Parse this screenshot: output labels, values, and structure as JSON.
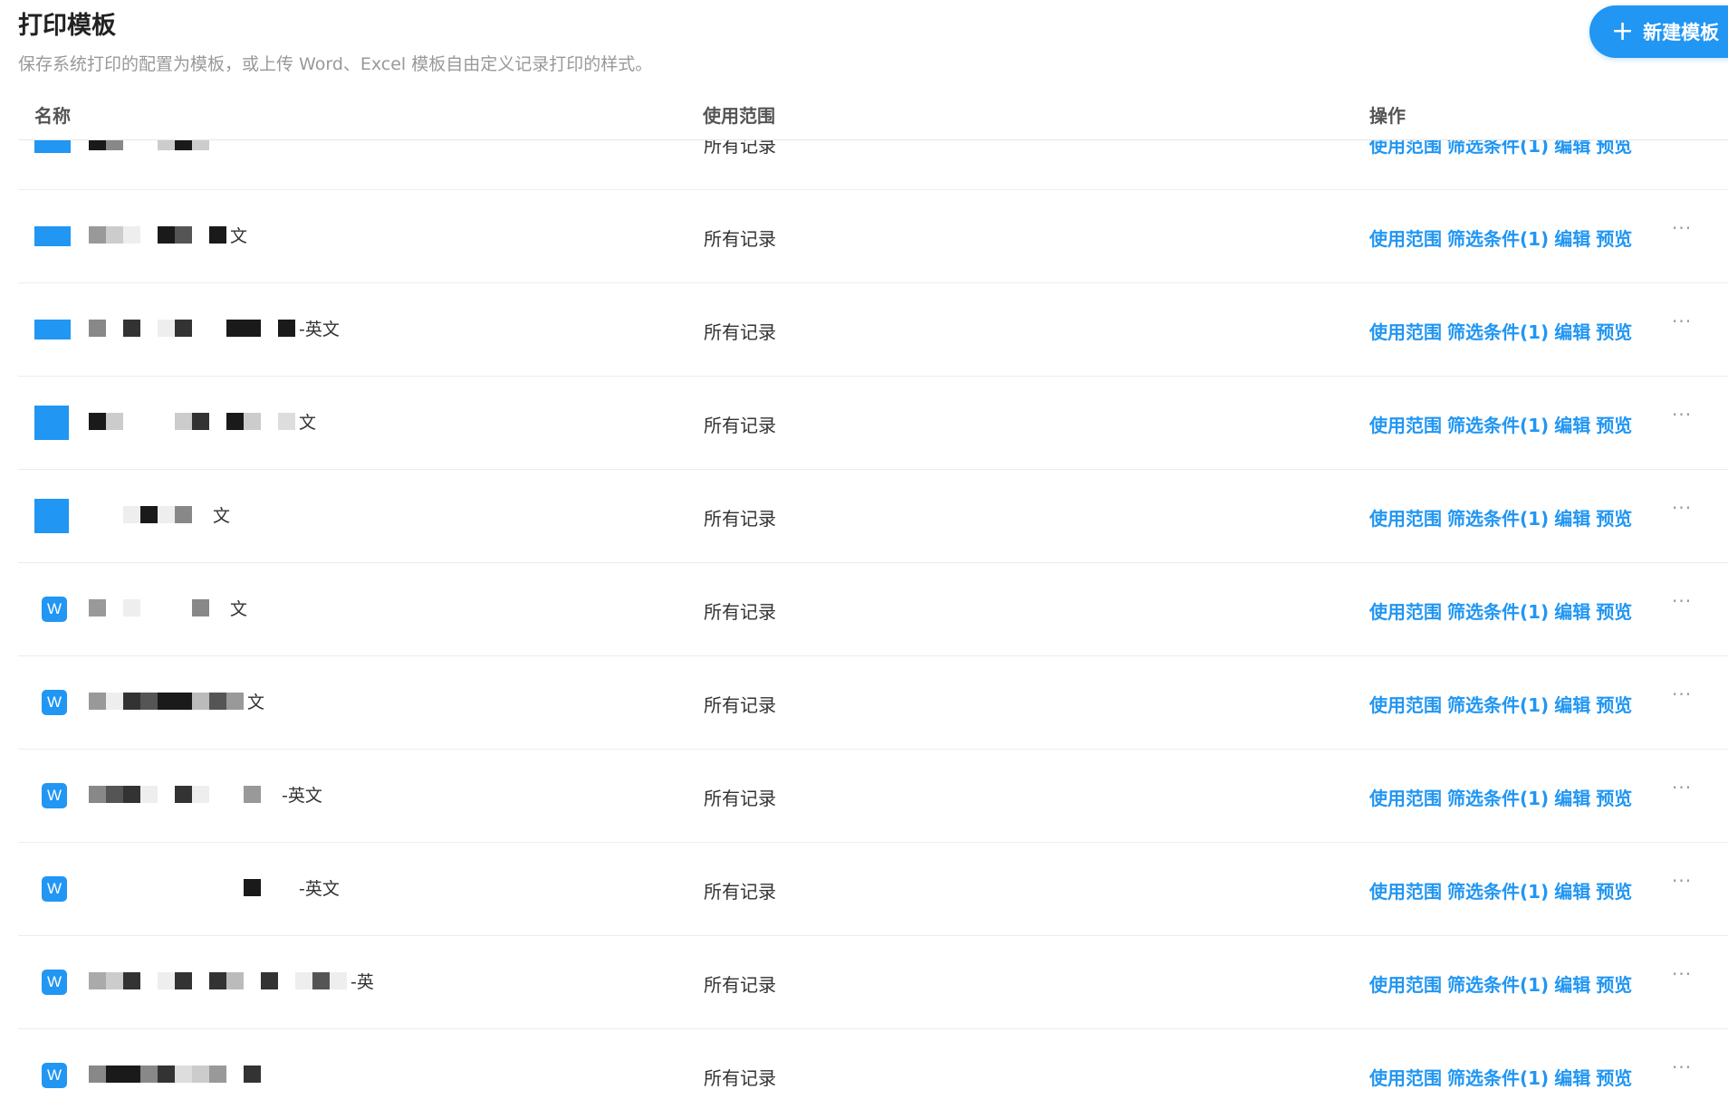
{
  "header": {
    "title": "打印模板",
    "description": "保存系统打印的配置为模板，或上传 Word、Excel 模板自由定义记录打印的样式。",
    "new_button_label": "新建模板",
    "new_button_icon": "plus-icon"
  },
  "table": {
    "columns": [
      "名称",
      "使用范围",
      "操作"
    ],
    "actions": {
      "scope": "使用范围",
      "filter": "筛选条件(1)",
      "edit": "编辑",
      "preview": "预览",
      "more": "···"
    },
    "rows": [
      {
        "icon": "system",
        "name_tail": "",
        "scope": "所有记录"
      },
      {
        "icon": "system",
        "name_tail": "文",
        "scope": "所有记录"
      },
      {
        "icon": "system",
        "name_tail": "-英文",
        "scope": "所有记录"
      },
      {
        "icon": "system-square",
        "name_tail": "文",
        "scope": "所有记录"
      },
      {
        "icon": "system-square",
        "name_tail": "文",
        "scope": "所有记录"
      },
      {
        "icon": "word",
        "name_tail": "文",
        "scope": "所有记录"
      },
      {
        "icon": "word",
        "name_tail": "文",
        "scope": "所有记录"
      },
      {
        "icon": "word",
        "name_tail": "-英文",
        "scope": "所有记录"
      },
      {
        "icon": "word",
        "name_tail": "-英文",
        "scope": "所有记录"
      },
      {
        "icon": "word",
        "name_tail": "-英",
        "scope": "所有记录"
      },
      {
        "icon": "word",
        "name_tail": "",
        "scope": "所有记录"
      }
    ],
    "word_icon_letter": "W"
  },
  "colors": {
    "accent": "#2196f3",
    "text": "#333333",
    "muted": "#999999"
  }
}
